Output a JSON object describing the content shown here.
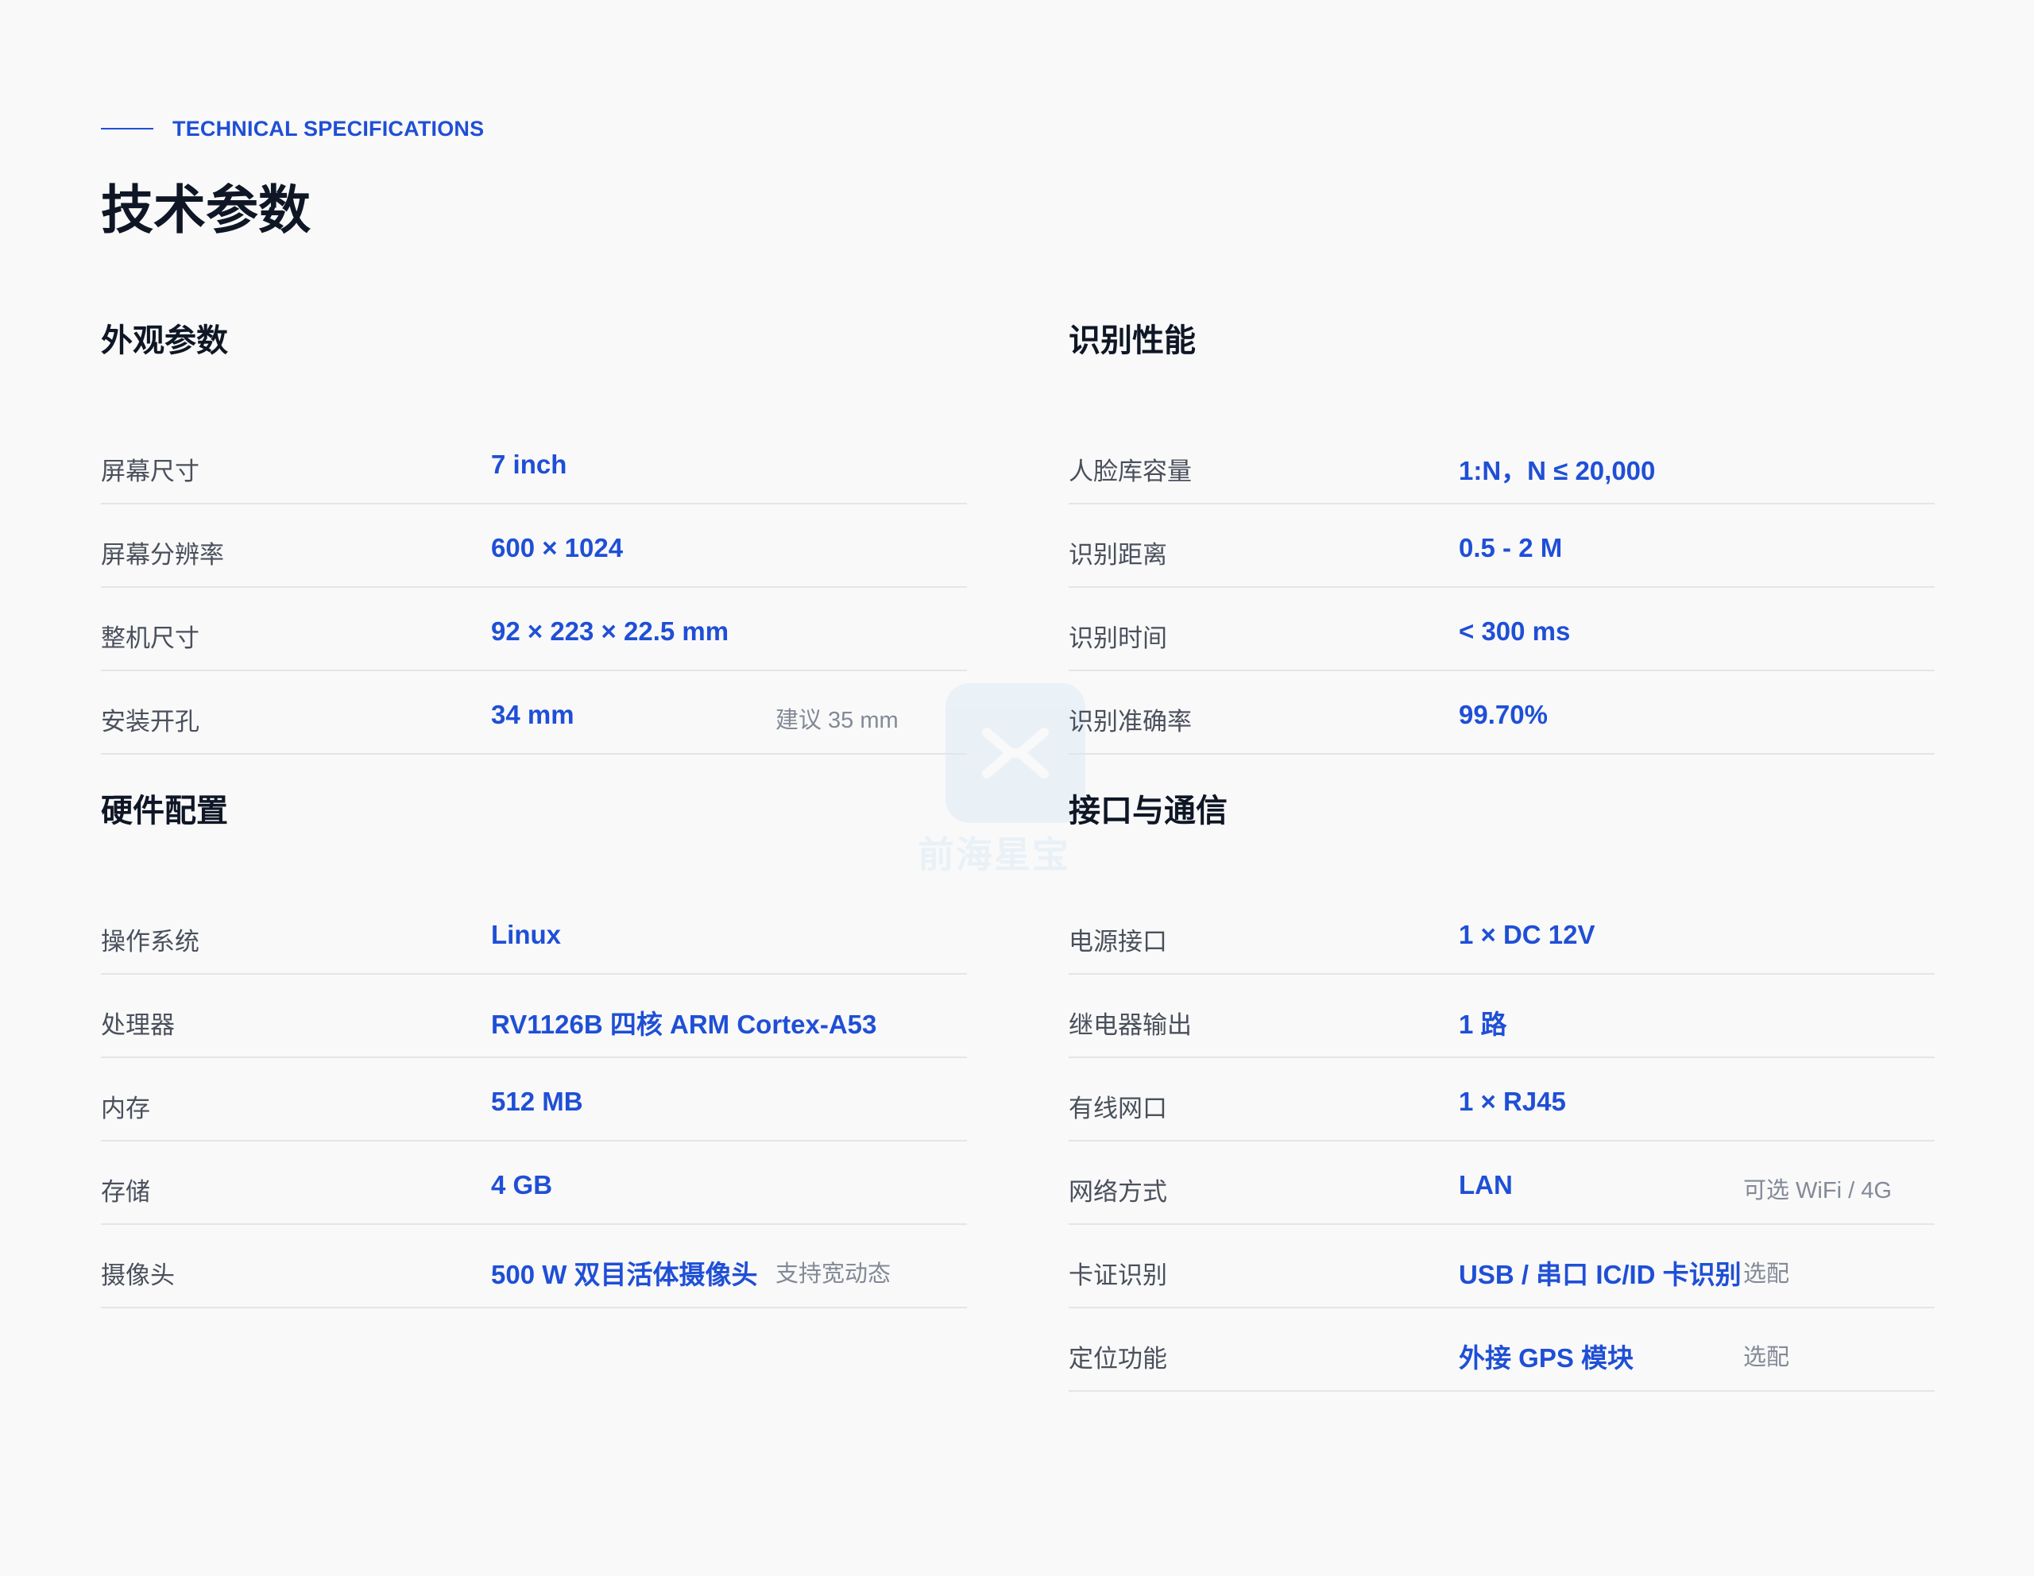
{
  "header": {
    "eyebrow": "TECHNICAL SPECIFICATIONS",
    "title": "技术参数"
  },
  "sections": [
    {
      "title": "外观参数",
      "rows": [
        {
          "label": "屏幕尺寸",
          "value": "7 inch",
          "note": ""
        },
        {
          "label": "屏幕分辨率",
          "value": "600 × 1024",
          "note": ""
        },
        {
          "label": "整机尺寸",
          "value": "92 × 223 × 22.5 mm",
          "note": ""
        },
        {
          "label": "安装开孔",
          "value": "34 mm",
          "note": "建议 35 mm"
        }
      ]
    },
    {
      "title": "识别性能",
      "rows": [
        {
          "label": "人脸库容量",
          "value": "1:N，N ≤ 20,000",
          "note": ""
        },
        {
          "label": "识别距离",
          "value": "0.5 - 2 M",
          "note": ""
        },
        {
          "label": "识别时间",
          "value": "< 300 ms",
          "note": ""
        },
        {
          "label": "识别准确率",
          "value": "99.70%",
          "note": ""
        }
      ]
    },
    {
      "title": "硬件配置",
      "rows": [
        {
          "label": "操作系统",
          "value": "Linux",
          "note": ""
        },
        {
          "label": "处理器",
          "value": "RV1126B 四核 ARM Cortex-A53",
          "note": ""
        },
        {
          "label": "内存",
          "value": "512 MB",
          "note": ""
        },
        {
          "label": "存储",
          "value": "4 GB",
          "note": ""
        },
        {
          "label": "摄像头",
          "value": "500 W 双目活体摄像头",
          "note": "支持宽动态"
        }
      ]
    },
    {
      "title": "接口与通信",
      "rows": [
        {
          "label": "电源接口",
          "value": "1 × DC 12V",
          "note": ""
        },
        {
          "label": "继电器输出",
          "value": "1 路",
          "note": ""
        },
        {
          "label": "有线网口",
          "value": "1 × RJ45",
          "note": ""
        },
        {
          "label": "网络方式",
          "value": "LAN",
          "note": "可选 WiFi / 4G"
        },
        {
          "label": "卡证识别",
          "value": "USB / 串口 IC/ID 卡识别",
          "note": "选配"
        },
        {
          "label": "定位功能",
          "value": "外接 GPS 模块",
          "note": "选配"
        }
      ]
    }
  ],
  "watermark": {
    "text": "前海星宝"
  },
  "colors": {
    "accent": "#1f4fd6",
    "background": "#f9f9f9",
    "heading": "#0f1726",
    "label": "#4a505c",
    "note": "#838996",
    "divider": "#e3e5ea"
  }
}
